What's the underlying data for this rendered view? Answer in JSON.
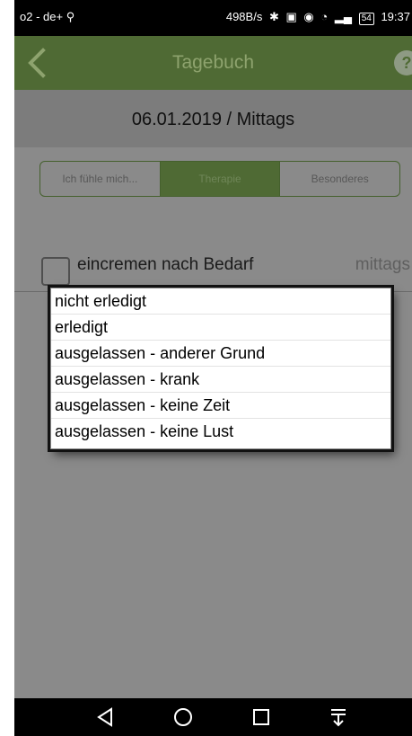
{
  "status_bar": {
    "carrier": "o2 - de+",
    "speed": "498B/s",
    "battery": "54",
    "time": "19:37"
  },
  "app_bar": {
    "title": "Tagebuch",
    "back_icon": "chevron-left-icon",
    "help_label": "?"
  },
  "date_header": {
    "text": "06.01.2019 / Mittags"
  },
  "tabs": [
    {
      "label": "Ich fühle mich...",
      "active": false
    },
    {
      "label": "Therapie",
      "active": true
    },
    {
      "label": "Besonderes",
      "active": false
    }
  ],
  "therapy_item": {
    "label": "eincremen nach Bedarf",
    "time": "mittags"
  },
  "dropdown": {
    "options": [
      "nicht erledigt",
      "erledigt",
      "ausgelassen - anderer Grund",
      "ausgelassen - krank",
      "ausgelassen - keine Zeit",
      "ausgelassen - keine Lust"
    ]
  },
  "colors": {
    "app_bar": "#4f6a34",
    "overlay_gray": "#8a8a8a",
    "status_bar": "#000000"
  }
}
